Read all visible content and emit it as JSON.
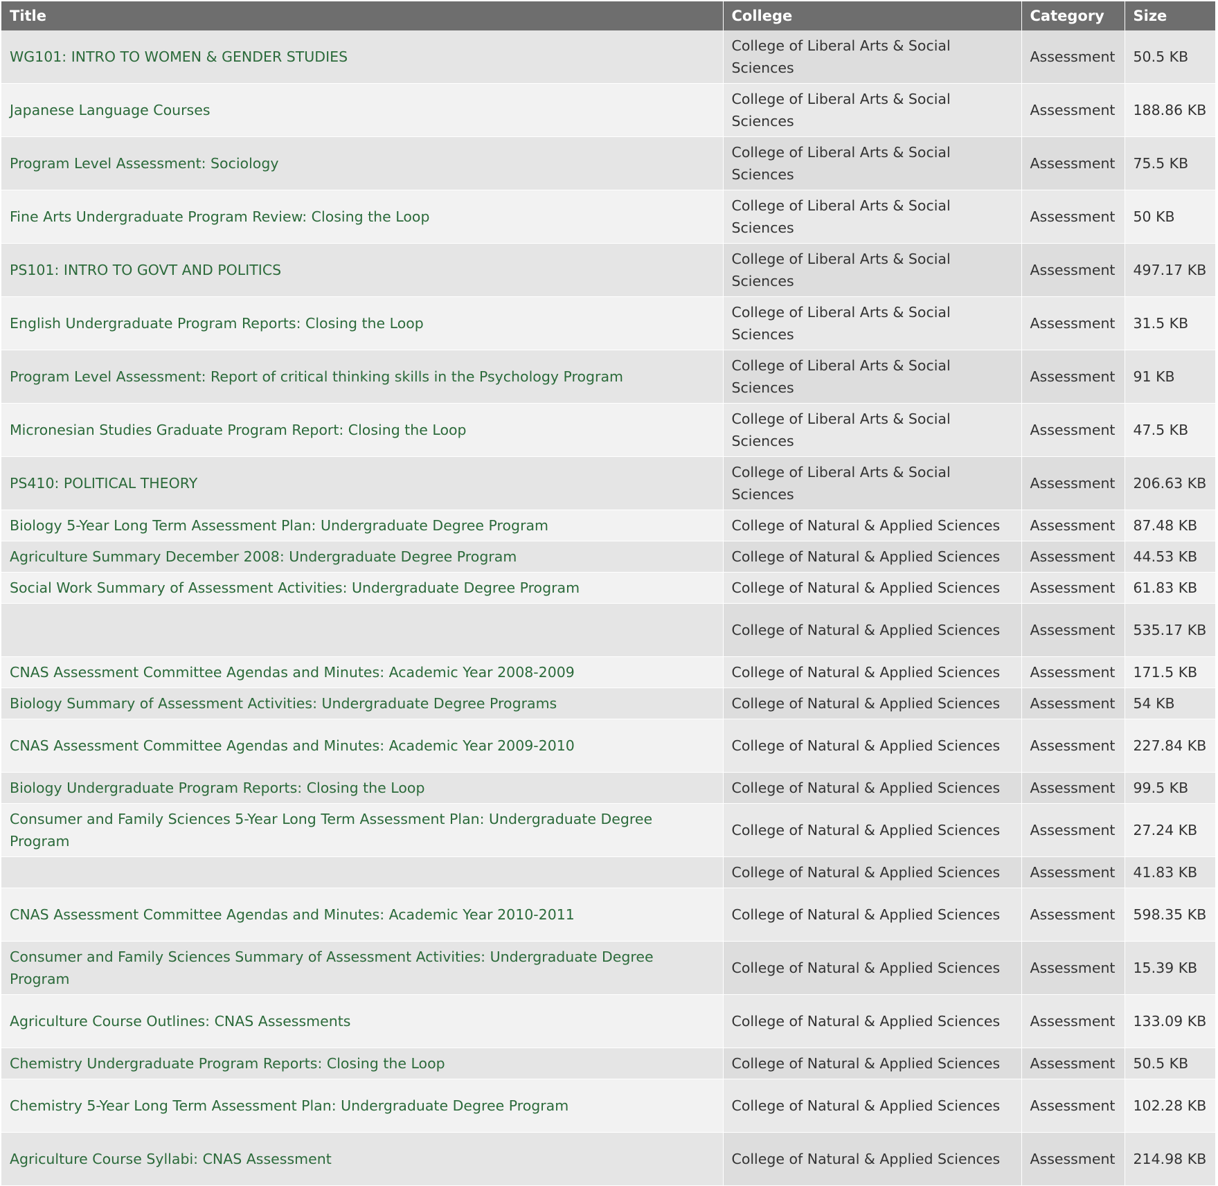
{
  "headers": {
    "title": "Title",
    "college": "College",
    "category": "Category",
    "size": "Size"
  },
  "rows": [
    {
      "title": "WG101: INTRO TO WOMEN & GENDER STUDIES",
      "college": "College of Liberal Arts & Social Sciences",
      "category": "Assessment",
      "size": "50.5 KB"
    },
    {
      "title": "Japanese Language Courses",
      "college": "College of Liberal Arts & Social Sciences",
      "category": "Assessment",
      "size": "188.86 KB"
    },
    {
      "title": "Program Level Assessment: Sociology",
      "college": "College of Liberal Arts & Social Sciences",
      "category": "Assessment",
      "size": "75.5 KB"
    },
    {
      "title": "Fine Arts Undergraduate Program Review: Closing the Loop",
      "college": "College of Liberal Arts & Social Sciences",
      "category": "Assessment",
      "size": "50 KB"
    },
    {
      "title": "PS101: INTRO TO GOVT AND POLITICS",
      "college": "College of Liberal Arts & Social Sciences",
      "category": "Assessment",
      "size": "497.17 KB"
    },
    {
      "title": "English Undergraduate Program Reports: Closing the Loop",
      "college": "College of Liberal Arts & Social Sciences",
      "category": "Assessment",
      "size": "31.5 KB"
    },
    {
      "title": "Program Level Assessment: Report of critical thinking skills in the Psychology Program",
      "college": "College of Liberal Arts & Social Sciences",
      "category": "Assessment",
      "size": "91 KB"
    },
    {
      "title": "Micronesian Studies Graduate Program Report: Closing the Loop",
      "college": "College of Liberal Arts & Social Sciences",
      "category": "Assessment",
      "size": "47.5 KB"
    },
    {
      "title": "PS410: POLITICAL THEORY",
      "college": "College of Liberal Arts & Social Sciences",
      "category": "Assessment",
      "size": "206.63 KB"
    },
    {
      "title": "Biology 5-Year Long Term Assessment Plan: Undergraduate Degree Program",
      "college": "College of Natural & Applied Sciences",
      "category": "Assessment",
      "size": "87.48 KB"
    },
    {
      "title": "Agriculture Summary December 2008: Undergraduate Degree Program",
      "college": "College of Natural & Applied Sciences",
      "category": "Assessment",
      "size": "44.53 KB"
    },
    {
      "title": "Social Work Summary of Assessment Activities: Undergraduate Degree Program",
      "college": "College of Natural & Applied Sciences",
      "category": "Assessment",
      "size": "61.83 KB"
    },
    {
      "title": "",
      "college": "College of Natural & Applied Sciences",
      "category": "Assessment",
      "size": "535.17 KB"
    },
    {
      "title": "CNAS Assessment Committee Agendas and Minutes: Academic Year 2008-2009",
      "college": "College of Natural & Applied Sciences",
      "category": "Assessment",
      "size": "171.5 KB"
    },
    {
      "title": "Biology Summary of Assessment Activities: Undergraduate Degree Programs",
      "college": "College of Natural & Applied Sciences",
      "category": "Assessment",
      "size": "54 KB"
    },
    {
      "title": "CNAS Assessment Committee Agendas and Minutes: Academic Year 2009-2010",
      "college": "College of Natural & Applied Sciences",
      "category": "Assessment",
      "size": "227.84 KB"
    },
    {
      "title": "Biology Undergraduate Program Reports: Closing the Loop",
      "college": "College of Natural & Applied Sciences",
      "category": "Assessment",
      "size": "99.5 KB"
    },
    {
      "title": "Consumer and Family Sciences 5-Year Long Term Assessment Plan: Undergraduate Degree Program",
      "college": "College of Natural & Applied Sciences",
      "category": "Assessment",
      "size": "27.24 KB"
    },
    {
      "title": "",
      "college": "College of Natural & Applied Sciences",
      "category": "Assessment",
      "size": "41.83 KB"
    },
    {
      "title": "CNAS Assessment Committee Agendas and Minutes: Academic Year 2010-2011",
      "college": "College of Natural & Applied Sciences",
      "category": "Assessment",
      "size": "598.35 KB"
    },
    {
      "title": "Consumer and Family Sciences Summary of Assessment Activities: Undergraduate Degree Program",
      "college": "College of Natural & Applied Sciences",
      "category": "Assessment",
      "size": "15.39 KB"
    },
    {
      "title": "Agriculture Course Outlines: CNAS Assessments",
      "college": "College of Natural & Applied Sciences",
      "category": "Assessment",
      "size": "133.09 KB"
    },
    {
      "title": "Chemistry Undergraduate Program Reports: Closing the Loop",
      "college": "College of Natural & Applied Sciences",
      "category": "Assessment",
      "size": "50.5 KB"
    },
    {
      "title": "Chemistry 5-Year Long Term Assessment Plan: Undergraduate Degree Program",
      "college": "College of Natural & Applied Sciences",
      "category": "Assessment",
      "size": "102.28 KB"
    },
    {
      "title": "Agriculture Course Syllabi: CNAS Assessment",
      "college": "College of Natural & Applied Sciences",
      "category": "Assessment",
      "size": "214.98 KB"
    }
  ]
}
